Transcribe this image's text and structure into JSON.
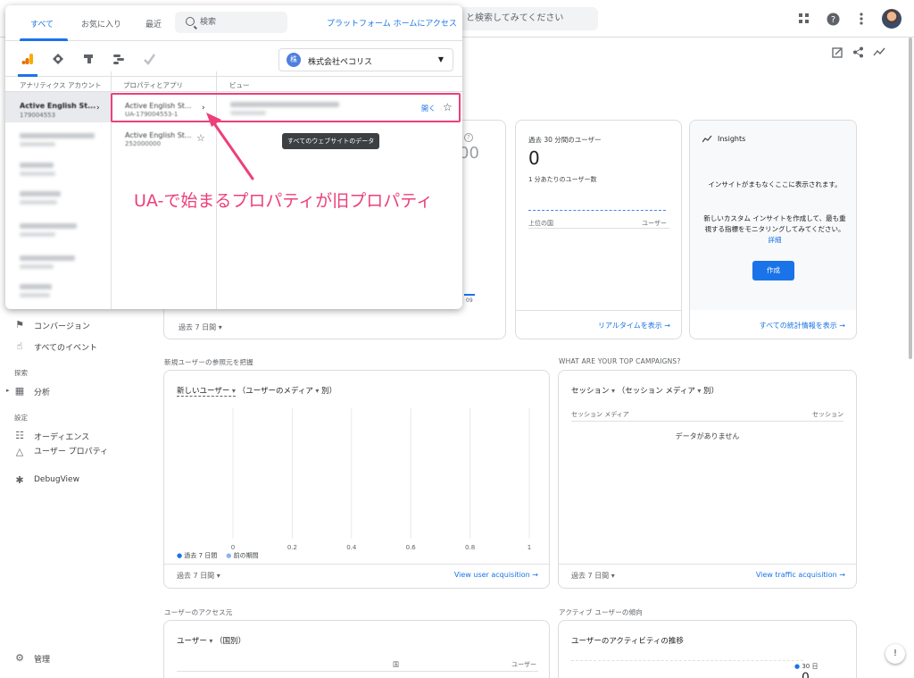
{
  "header": {
    "search_placeholder": "と検索してみてください"
  },
  "picker": {
    "tabs": [
      "すべて",
      "お気に入り",
      "最近"
    ],
    "search_placeholder": "検索",
    "platform_link": "プラットフォーム ホームにアクセス",
    "company": {
      "badge": "株",
      "name": "株式会社ペコリス"
    },
    "columns": {
      "accounts": "アナリティクス アカウント",
      "properties": "プロパティとアプリ",
      "views": "ビュー"
    },
    "selected_account": {
      "name": "Active English St...",
      "id": "179004553"
    },
    "properties": [
      {
        "name": "Active English St...",
        "id": "UA-179004553-1"
      },
      {
        "name": "Active English St...",
        "id": "252000000"
      }
    ],
    "open_link": "開く",
    "tooltip": "すべてのウェブサイトのデータ"
  },
  "annotation": "UA-で始まるプロパティが旧プロパティ",
  "nav": {
    "conversions": "コンバージョン",
    "all_events": "すべてのイベント",
    "explore_section": "探索",
    "analysis": "分析",
    "settings_section": "設定",
    "audiences": "オーディエンス",
    "user_properties": "ユーザー プロパティ",
    "debugview": "DebugView",
    "admin": "管理"
  },
  "realtime": {
    "title": "過去 30 分間のユーザー",
    "value": "0",
    "per_minute": "1 分あたりのユーザー数",
    "col_country": "上位の国",
    "col_users": "ユーザー",
    "link": "リアルタイムを表示"
  },
  "partial_card": {
    "value": "00",
    "axis_tick": "09",
    "period": "過去 7 日間"
  },
  "insights": {
    "title": "Insights",
    "line1": "インサイトがまもなくここに表示されます。",
    "line2": "新しいカスタム インサイトを作成して、最も重視する指標をモニタリングしてみてください。",
    "detail_link": "詳細",
    "create_button": "作成",
    "footer_link": "すべての統計情報を表示"
  },
  "acquisition": {
    "section": "新規ユーザーの参照元を把握",
    "metric": "新しいユーザー",
    "dimension": "（ユーザーのメディア",
    "suffix": "別）",
    "x_ticks": [
      "0",
      "0.2",
      "0.4",
      "0.6",
      "0.8",
      "1"
    ],
    "legend": [
      "過去 7 日間",
      "前の期間"
    ],
    "period": "過去 7 日間",
    "link": "View user acquisition"
  },
  "campaigns": {
    "section": "WHAT ARE YOUR TOP CAMPAIGNS?",
    "metric": "セッション",
    "dimension": "（セッション メディア",
    "suffix": "別）",
    "col_left": "セッション メディア",
    "col_right": "セッション",
    "empty": "データがありません",
    "period": "過去 7 日間",
    "link": "View traffic acquisition"
  },
  "access": {
    "section": "ユーザーのアクセス元",
    "metric": "ユーザー",
    "dimension": "（国別）",
    "col_left": "国",
    "col_right": "ユーザー"
  },
  "activity": {
    "section": "アクティブ ユーザーの傾向",
    "title": "ユーザーのアクティビティの推移",
    "legend": "30 日",
    "value": "0"
  }
}
